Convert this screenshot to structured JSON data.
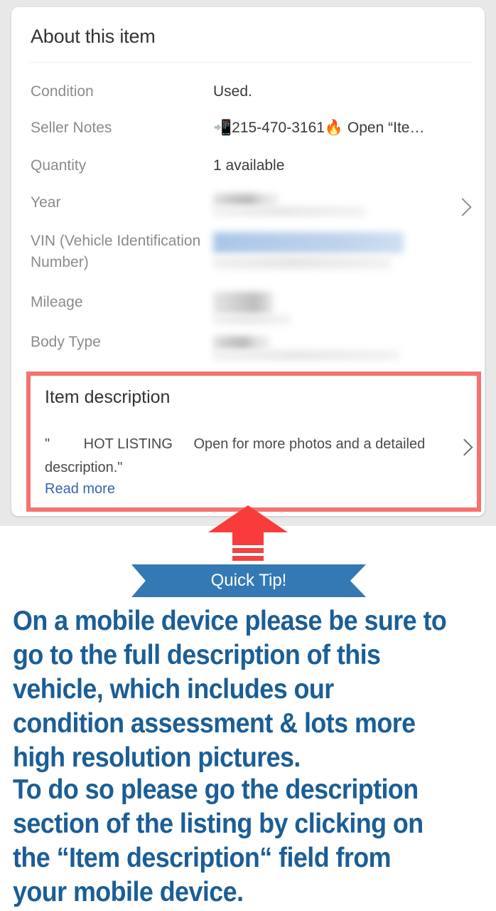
{
  "card": {
    "title": "About this item",
    "specs": [
      {
        "label": "Condition",
        "value": "Used.",
        "redacted": false,
        "chevron": false
      },
      {
        "label": "Seller Notes",
        "value": "📲215-470-3161🔥 Open “Ite…",
        "redacted": false,
        "chevron": false
      },
      {
        "label": "Quantity",
        "value": "1 available",
        "redacted": false,
        "chevron": false
      },
      {
        "label": "Year",
        "value": "",
        "redacted": true,
        "chevron": true
      },
      {
        "label": "VIN (Vehicle Identification Number)",
        "value": "",
        "redacted": true,
        "chevron": false
      },
      {
        "label": "Mileage",
        "value": "",
        "redacted": true,
        "chevron": false
      },
      {
        "label": "Body Type",
        "value": "",
        "redacted": true,
        "chevron": false
      }
    ]
  },
  "item_description": {
    "title": "Item description",
    "snippet_quote_open": "\"",
    "snippet_hot": "HOT LISTING",
    "snippet_body": "Open for more photos and a",
    "snippet_tail": "detailed description.\"",
    "read_more_label": "Read more"
  },
  "callout": {
    "banner_label": "Quick Tip!",
    "paragraph_1": "On a mobile device please be sure to go to the full description of this vehicle, which includes our condition assessment & lots more high resolution pictures.",
    "paragraph_2_part_1": "To do so please go the description section of the listing by clicking on the “",
    "paragraph_2_bold": "Item description",
    "paragraph_2_part_2": "“ field from your mobile device."
  },
  "colors": {
    "highlight_border": "#f4726f",
    "arrow_red": "#fa3b3b",
    "banner_blue": "#3579b4",
    "text_blue": "#1b5e96",
    "link_blue": "#3665af",
    "page_bg": "#e8e8e8",
    "card_bg": "#ffffff"
  },
  "icons": {
    "chevron_right": "›",
    "mobile_phone": "📲",
    "fire": "🔥"
  }
}
